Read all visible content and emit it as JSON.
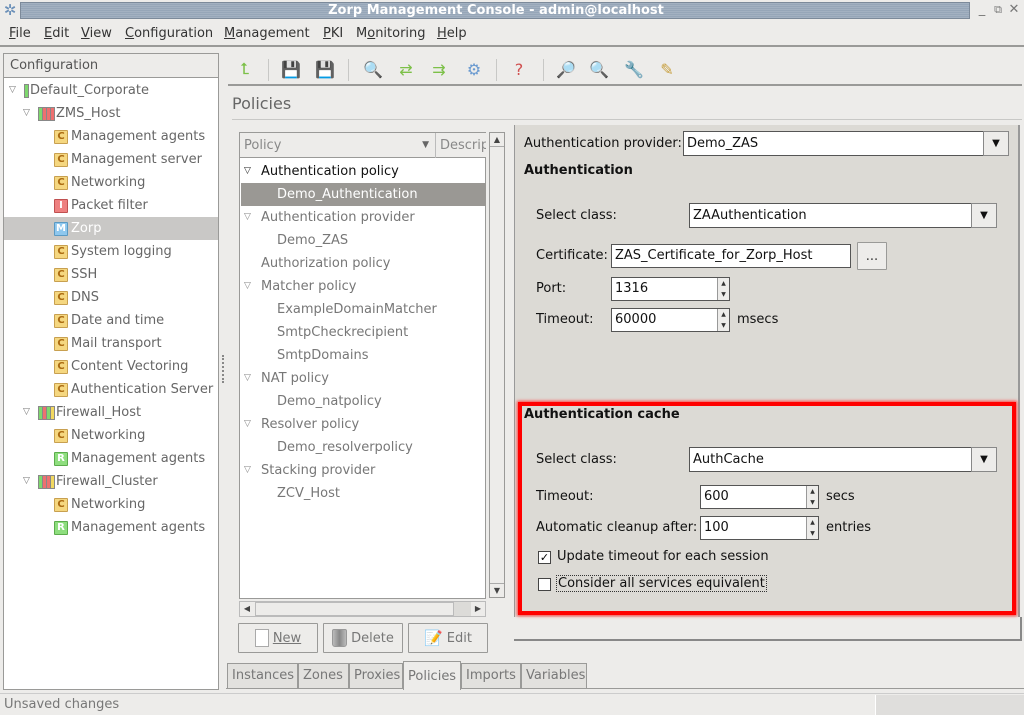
{
  "window": {
    "title": "Zorp Management Console - admin@localhost",
    "controls": [
      "minimize",
      "restore",
      "close"
    ]
  },
  "menubar": {
    "items": [
      {
        "label": "File",
        "mnemonic": "F"
      },
      {
        "label": "Edit",
        "mnemonic": "E"
      },
      {
        "label": "View",
        "mnemonic": "V"
      },
      {
        "label": "Configuration",
        "mnemonic": "C"
      },
      {
        "label": "Management",
        "mnemonic": "M"
      },
      {
        "label": "PKI",
        "mnemonic": "P"
      },
      {
        "label": "Monitoring",
        "mnemonic": "o"
      },
      {
        "label": "Help",
        "mnemonic": "H"
      }
    ]
  },
  "sidebar": {
    "header": "Configuration",
    "tree": [
      {
        "label": "Default_Corporate",
        "level": 0,
        "expanded": true,
        "icon": "site-status",
        "bars": [
          "#7ed86e"
        ]
      },
      {
        "label": "ZMS_Host",
        "level": 1,
        "expanded": true,
        "icon": "host-status",
        "bars": [
          "#7ed86e",
          "#ee7070",
          "#ee7070",
          "#ee7070"
        ]
      },
      {
        "label": "Management agents",
        "level": 2,
        "badge": "C"
      },
      {
        "label": "Management server",
        "level": 2,
        "badge": "C"
      },
      {
        "label": "Networking",
        "level": 2,
        "badge": "C"
      },
      {
        "label": "Packet filter",
        "level": 2,
        "badge": "I"
      },
      {
        "label": "Zorp",
        "level": 2,
        "badge": "M",
        "selected": true
      },
      {
        "label": "System logging",
        "level": 2,
        "badge": "C"
      },
      {
        "label": "SSH",
        "level": 2,
        "badge": "C"
      },
      {
        "label": "DNS",
        "level": 2,
        "badge": "C"
      },
      {
        "label": "Date and time",
        "level": 2,
        "badge": "C"
      },
      {
        "label": "Mail transport",
        "level": 2,
        "badge": "C"
      },
      {
        "label": "Content Vectoring",
        "level": 2,
        "badge": "C"
      },
      {
        "label": "Authentication Server",
        "level": 2,
        "badge": "C"
      },
      {
        "label": "Firewall_Host",
        "level": 1,
        "expanded": true,
        "icon": "host-status",
        "bars": [
          "#7ed86e",
          "#ee7070",
          "#7ed86e",
          "#f2d860"
        ]
      },
      {
        "label": "Networking",
        "level": 2,
        "badge": "C"
      },
      {
        "label": "Management agents",
        "level": 2,
        "badge": "R"
      },
      {
        "label": "Firewall_Cluster",
        "level": 1,
        "expanded": true,
        "icon": "host-status",
        "bars": [
          "#7ed86e",
          "#ee7070",
          "#ee7070",
          "#f2d860"
        ]
      },
      {
        "label": "Networking",
        "level": 2,
        "badge": "C"
      },
      {
        "label": "Management agents",
        "level": 2,
        "badge": "R"
      }
    ]
  },
  "toolbar": {
    "buttons": [
      {
        "name": "up-level",
        "glyph": "⮤",
        "color": "#7cc048"
      },
      {
        "name": "commit",
        "glyph": "💾",
        "color": "#4a90c0"
      },
      {
        "name": "revert",
        "glyph": "💾",
        "color": "#d05050"
      },
      {
        "name": "view-config",
        "glyph": "🔍",
        "color": "#777"
      },
      {
        "name": "compare",
        "glyph": "⇄",
        "color": "#7cc048"
      },
      {
        "name": "upload",
        "glyph": "⇉",
        "color": "#7cc048"
      },
      {
        "name": "settings",
        "glyph": "⚙",
        "color": "#6a9ad0"
      },
      {
        "name": "status",
        "glyph": "?",
        "color": "#d05050"
      },
      {
        "name": "search-global",
        "glyph": "🔎",
        "color": "#6a9a6a"
      },
      {
        "name": "search-log",
        "glyph": "🔍",
        "color": "#777"
      },
      {
        "name": "tools",
        "glyph": "🔧",
        "color": "#888"
      },
      {
        "name": "notes",
        "glyph": "✎",
        "color": "#c8a040"
      }
    ]
  },
  "main": {
    "heading": "Policies",
    "policy_list": {
      "columns": [
        "Policy",
        "Descrip"
      ],
      "rows": [
        {
          "label": "Authentication policy",
          "level": 0,
          "expandable": true,
          "dark": true
        },
        {
          "label": "Demo_Authentication",
          "level": 1,
          "selected": true
        },
        {
          "label": "Authentication provider",
          "level": 0,
          "expandable": true
        },
        {
          "label": "Demo_ZAS",
          "level": 1
        },
        {
          "label": "Authorization policy",
          "level": 0
        },
        {
          "label": "Matcher policy",
          "level": 0,
          "expandable": true
        },
        {
          "label": "ExampleDomainMatcher",
          "level": 1
        },
        {
          "label": "SmtpCheckrecipient",
          "level": 1
        },
        {
          "label": "SmtpDomains",
          "level": 1
        },
        {
          "label": "NAT policy",
          "level": 0,
          "expandable": true
        },
        {
          "label": "Demo_natpolicy",
          "level": 1
        },
        {
          "label": "Resolver policy",
          "level": 0,
          "expandable": true
        },
        {
          "label": "Demo_resolverpolicy",
          "level": 1
        },
        {
          "label": "Stacking provider",
          "level": 0,
          "expandable": true
        },
        {
          "label": "ZCV_Host",
          "level": 1
        }
      ]
    },
    "buttons": {
      "new": "New",
      "delete": "Delete",
      "edit": "Edit"
    },
    "detail": {
      "provider_label": "Authentication provider:",
      "provider_value": "Demo_ZAS",
      "auth_section": "Authentication",
      "auth_class_label": "Select class:",
      "auth_class_value": "ZAAuthentication",
      "certificate_label": "Certificate:",
      "certificate_value": "ZAS_Certificate_for_Zorp_Host",
      "browse_label": "...",
      "port_label": "Port:",
      "port_value": "1316",
      "timeout_label": "Timeout:",
      "timeout_value": "60000",
      "timeout_unit": "msecs",
      "cache_section": "Authentication cache",
      "cache_class_label": "Select class:",
      "cache_class_value": "AuthCache",
      "cache_timeout_label": "Timeout:",
      "cache_timeout_value": "600",
      "cache_timeout_unit": "secs",
      "cleanup_label": "Automatic cleanup after:",
      "cleanup_value": "100",
      "cleanup_unit": "entries",
      "update_timeout_label": "Update timeout for each session",
      "update_timeout_checked": true,
      "equivalent_label": "Consider all services equivalent",
      "equivalent_checked": false,
      "highlight_color": "#ff0000"
    },
    "tabs": [
      {
        "label": "Instances"
      },
      {
        "label": "Zones"
      },
      {
        "label": "Proxies"
      },
      {
        "label": "Policies",
        "active": true
      },
      {
        "label": "Imports"
      },
      {
        "label": "Variables"
      }
    ]
  },
  "statusbar": {
    "text": "Unsaved changes"
  }
}
